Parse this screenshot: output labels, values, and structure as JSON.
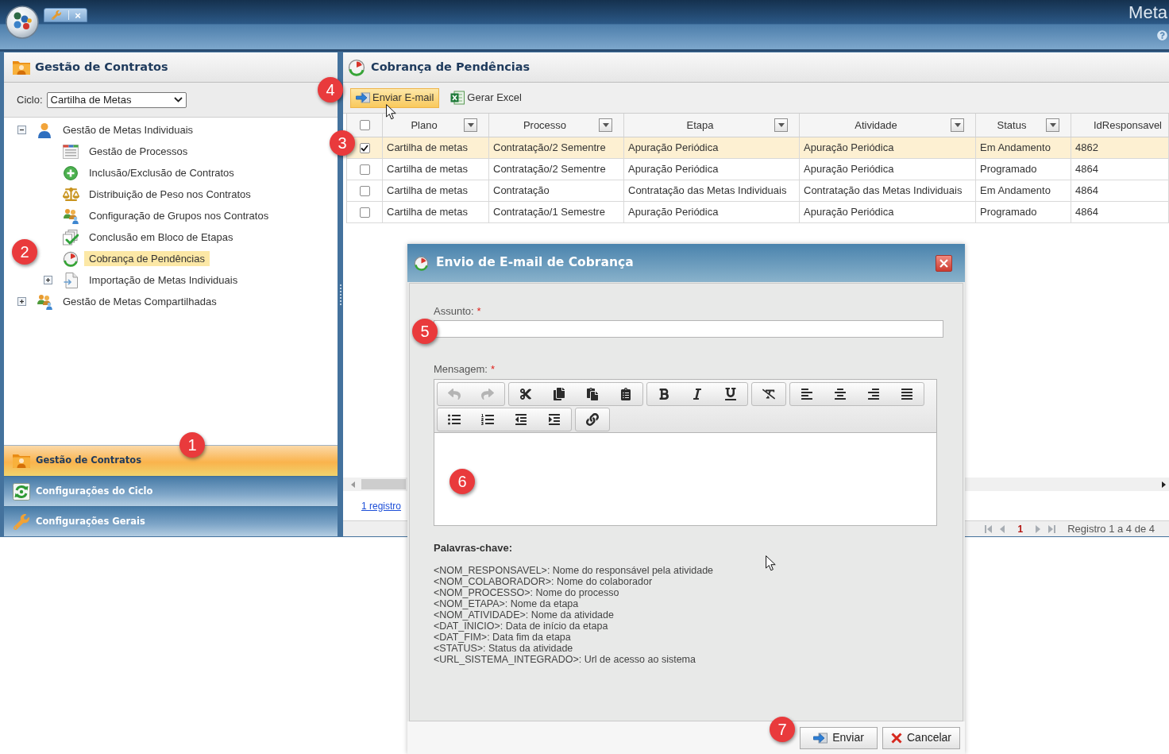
{
  "app_bar": {
    "tab": {
      "close": "×"
    },
    "title": "Meta"
  },
  "side_panel": {
    "title": "Gestão de Contratos",
    "cycle": {
      "label": "Ciclo:",
      "value": "Cartilha de Metas"
    },
    "tree": [
      {
        "kind": "branch",
        "label": "Gestão de Metas Individuais",
        "expanded": true,
        "selected": false,
        "children": [
          {
            "kind": "leaf",
            "label": "Gestão de Processos",
            "selected": false
          },
          {
            "kind": "leaf",
            "label": "Inclusão/Exclusão de Contratos",
            "selected": false
          },
          {
            "kind": "leaf",
            "label": "Distribuição de Peso nos Contratos",
            "selected": false
          },
          {
            "kind": "leaf",
            "label": "Configuração de Grupos nos Contratos",
            "selected": false
          },
          {
            "kind": "leaf",
            "label": "Conclusão em Bloco de Etapas",
            "selected": false
          },
          {
            "kind": "leaf",
            "label": "Cobrança de Pendências",
            "selected": true
          },
          {
            "kind": "branch",
            "label": "Importação de Metas Individuais",
            "expanded": false,
            "selected": false
          }
        ]
      },
      {
        "kind": "branch",
        "label": "Gestão de Metas Compartilhadas",
        "expanded": false,
        "selected": false
      }
    ],
    "accordion": [
      {
        "label": "Gestão de Contratos",
        "selected": true
      },
      {
        "label": "Configurações do Ciclo",
        "selected": false
      },
      {
        "label": "Configurações Gerais",
        "selected": false
      }
    ]
  },
  "main_panel": {
    "title": "Cobrança de Pendências",
    "toolbar": [
      {
        "label": "Enviar E-mail",
        "hovered": true
      },
      {
        "label": "Gerar Excel",
        "hovered": false
      }
    ],
    "table": {
      "select_all": {
        "checked": false
      },
      "columns": [
        {
          "label": "Plano",
          "filter": true
        },
        {
          "label": "Processo",
          "filter": true
        },
        {
          "label": "Etapa",
          "filter": true
        },
        {
          "label": "Atividade",
          "filter": true
        },
        {
          "label": "Status",
          "filter": true
        },
        {
          "label": "IdResponsavel",
          "filter": false
        }
      ],
      "rows": [
        {
          "checked": true,
          "selected": true,
          "cells": [
            "Cartilha de metas",
            "Contratação/2 Sementre",
            "Apuração Periódica",
            "Apuração Periódica",
            "Em Andamento",
            "4862"
          ]
        },
        {
          "checked": false,
          "selected": false,
          "cells": [
            "Cartilha de metas",
            "Contratação/2 Sementre",
            "Apuração Periódica",
            "Apuração Periódica",
            "Programado",
            "4864"
          ]
        },
        {
          "checked": false,
          "selected": false,
          "cells": [
            "Cartilha de metas",
            "Contratação",
            "Contratação das Metas Individuais",
            "Contratação das Metas Individuais",
            "Em Andamento",
            "4864"
          ]
        },
        {
          "checked": false,
          "selected": false,
          "cells": [
            "Cartilha de metas",
            "Contratação/1 Semestre",
            "Apuração Periódica",
            "Apuração Periódica",
            "Programado",
            "4864"
          ]
        }
      ]
    },
    "selection_link": "1 registro",
    "pager": {
      "page": "1",
      "summary": "Registro 1 a 4 de 4"
    }
  },
  "dialog": {
    "title": "Envio de E-mail de Cobrança",
    "subject": {
      "label": "Assunto:",
      "required_mark": "*"
    },
    "message": {
      "label": "Mensagem:",
      "required_mark": "*",
      "toolbar": [
        {
          "buttons": [
            {
              "disabled": true
            },
            {
              "disabled": true
            }
          ]
        },
        {
          "buttons": [
            {
              "disabled": false
            },
            {
              "disabled": false
            },
            {
              "disabled": false
            },
            {
              "disabled": false
            }
          ]
        },
        {
          "buttons": [
            {
              "disabled": false
            },
            {
              "disabled": false
            },
            {
              "disabled": false
            }
          ]
        },
        {
          "buttons": [
            {
              "disabled": false
            }
          ]
        },
        {
          "buttons": [
            {
              "disabled": false
            },
            {
              "disabled": false
            },
            {
              "disabled": false
            },
            {
              "disabled": false
            }
          ]
        },
        {
          "buttons": [
            {
              "disabled": false
            },
            {
              "disabled": false
            },
            {
              "disabled": false
            },
            {
              "disabled": false
            }
          ]
        },
        {
          "buttons": [
            {
              "disabled": false
            }
          ]
        }
      ]
    },
    "keywords": {
      "title": "Palavras-chave:",
      "items": [
        "<NOM_RESPONSAVEL>: Nome do responsável pela atividade",
        "<NOM_COLABORADOR>: Nome do colaborador",
        "<NOM_PROCESSO>: Nome do processo",
        "<NOM_ETAPA>: Nome da etapa",
        "<NOM_ATIVIDADE>: Nome da atividade",
        "<DAT_INICIO>: Data de início da etapa",
        "<DAT_FIM>: Data fim da etapa",
        "<STATUS>: Status da atividade",
        "<URL_SISTEMA_INTEGRADO>: Url de acesso ao sistema"
      ]
    },
    "buttons": [
      {
        "label": "Enviar"
      },
      {
        "label": "Cancelar"
      }
    ]
  },
  "annotations": [
    {
      "label": "1"
    },
    {
      "label": "2"
    },
    {
      "label": "3"
    },
    {
      "label": "4"
    },
    {
      "label": "5"
    },
    {
      "label": "6"
    },
    {
      "label": "7"
    }
  ]
}
